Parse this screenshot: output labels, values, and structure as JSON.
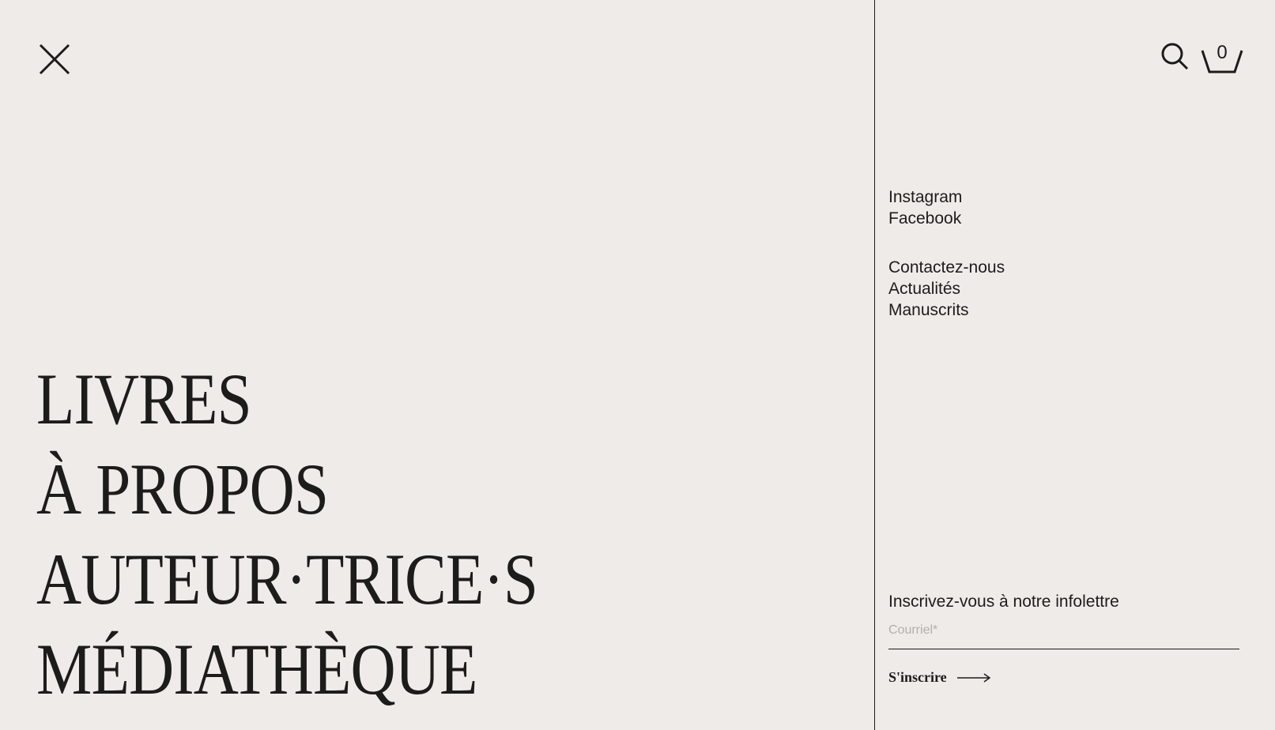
{
  "menu": {
    "close_icon": "close-icon",
    "main_items": [
      {
        "label": "LIVRES"
      },
      {
        "label": "À PROPOS"
      },
      {
        "label": "AUTEUR·TRICE·S"
      },
      {
        "label": "MÉDIATHÈQUE"
      }
    ]
  },
  "header": {
    "search_icon": "search-icon",
    "cart_icon": "basket-icon",
    "cart_count": "0"
  },
  "social_links": [
    {
      "label": "Instagram"
    },
    {
      "label": "Facebook"
    }
  ],
  "info_links": [
    {
      "label": "Contactez-nous"
    },
    {
      "label": "Actualités"
    },
    {
      "label": "Manuscrits"
    }
  ],
  "newsletter": {
    "title": "Inscrivez-vous à notre infolettre",
    "email_placeholder": "Courriel*",
    "email_value": "",
    "submit_label": "S'inscrire",
    "submit_icon": "arrow-right-icon"
  },
  "colors": {
    "background": "#efebe8",
    "text": "#1c1c1a",
    "placeholder": "#b3afab"
  }
}
